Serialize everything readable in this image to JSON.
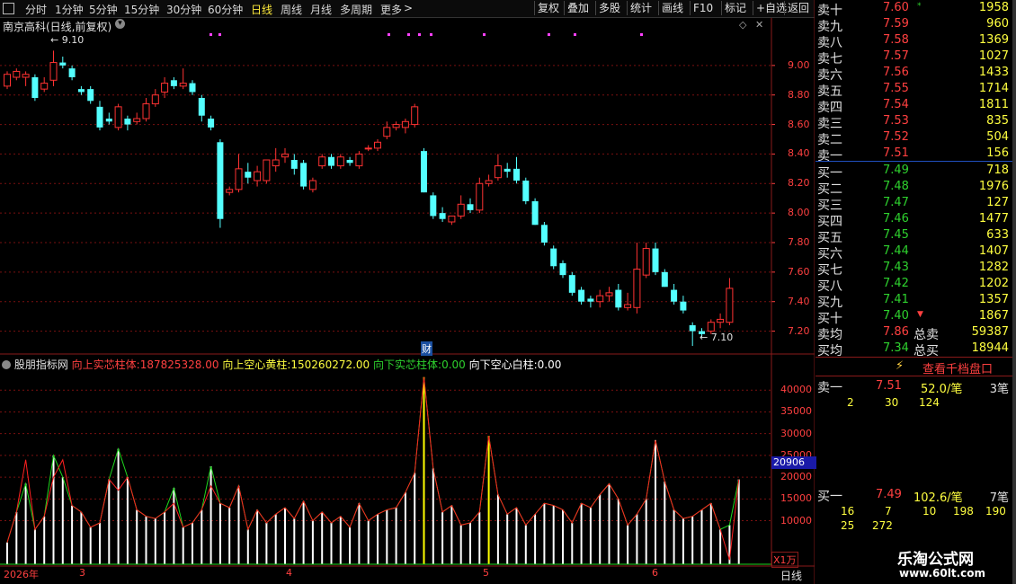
{
  "toolbar": {
    "left_icon": "square-icon",
    "periods": [
      "分时",
      "1分钟",
      "5分钟",
      "15分钟",
      "30分钟",
      "60分钟",
      "日线",
      "周线",
      "月线",
      "多周期",
      "更多"
    ],
    "active_period": "日线",
    "more_arrow": ">",
    "buttons": [
      "复权",
      "叠加",
      "多股",
      "统计",
      "画线",
      "F10",
      "标记",
      "+自选",
      "返回"
    ]
  },
  "chart": {
    "title": "南京高科(日线,前复权)",
    "high_marker": "9.10",
    "low_marker": "7.10",
    "finance_marker": "财",
    "price_axis": [
      "9.00",
      "8.80",
      "8.60",
      "8.40",
      "8.20",
      "8.00",
      "7.80",
      "7.60",
      "7.40",
      "7.20"
    ],
    "volume_axis": [
      "40000",
      "35000",
      "30000",
      "25000",
      "20000",
      "15000",
      "10000"
    ],
    "volume_highlight": "20906",
    "unit_label": "X1万",
    "period_label": "日线",
    "date_labels": [
      "2026年",
      "3",
      "4",
      "5",
      "6"
    ],
    "colors": {
      "up": "#ff3232",
      "down": "#54ffff",
      "grid": "#7a1010",
      "yellow_line": "#ffff00"
    }
  },
  "indicator": {
    "name": "股朋指标网",
    "items": [
      {
        "label": "向上实芯柱体:",
        "value": "187825328.00",
        "color": "#ff4040"
      },
      {
        "label": "向上空心黄柱:",
        "value": "150260272.00",
        "color": "#ffff40"
      },
      {
        "label": "向下实芯柱体:",
        "value": "0.00",
        "color": "#2ed12e"
      },
      {
        "label": "向下空心白柱:",
        "value": "0.00",
        "color": "#ffffff"
      }
    ]
  },
  "chart_data": {
    "type": "bar",
    "title": "南京高科(日线,前复权)",
    "xlabel": "",
    "ylabel": "",
    "ylim": [
      7.1,
      9.2
    ],
    "candles": [
      {
        "o": 8.86,
        "h": 8.96,
        "l": 8.84,
        "c": 8.94
      },
      {
        "o": 8.92,
        "h": 8.98,
        "l": 8.9,
        "c": 8.96
      },
      {
        "o": 8.92,
        "h": 8.96,
        "l": 8.86,
        "c": 8.94
      },
      {
        "o": 8.92,
        "h": 8.94,
        "l": 8.76,
        "c": 8.78
      },
      {
        "o": 8.84,
        "h": 8.92,
        "l": 8.82,
        "c": 8.88
      },
      {
        "o": 8.9,
        "h": 9.1,
        "l": 8.86,
        "c": 9.02
      },
      {
        "o": 9.02,
        "h": 9.06,
        "l": 8.98,
        "c": 9.0
      },
      {
        "o": 8.98,
        "h": 9.0,
        "l": 8.9,
        "c": 8.92
      },
      {
        "o": 8.84,
        "h": 8.86,
        "l": 8.8,
        "c": 8.82
      },
      {
        "o": 8.84,
        "h": 8.86,
        "l": 8.74,
        "c": 8.76
      },
      {
        "o": 8.72,
        "h": 8.76,
        "l": 8.56,
        "c": 8.58
      },
      {
        "o": 8.64,
        "h": 8.68,
        "l": 8.6,
        "c": 8.62
      },
      {
        "o": 8.58,
        "h": 8.74,
        "l": 8.56,
        "c": 8.72
      },
      {
        "o": 8.64,
        "h": 8.66,
        "l": 8.56,
        "c": 8.6
      },
      {
        "o": 8.62,
        "h": 8.68,
        "l": 8.6,
        "c": 8.64
      },
      {
        "o": 8.64,
        "h": 8.78,
        "l": 8.62,
        "c": 8.74
      },
      {
        "o": 8.74,
        "h": 8.84,
        "l": 8.72,
        "c": 8.8
      },
      {
        "o": 8.82,
        "h": 8.92,
        "l": 8.78,
        "c": 8.88
      },
      {
        "o": 8.9,
        "h": 8.92,
        "l": 8.84,
        "c": 8.86
      },
      {
        "o": 8.86,
        "h": 8.98,
        "l": 8.84,
        "c": 8.88
      },
      {
        "o": 8.88,
        "h": 8.9,
        "l": 8.8,
        "c": 8.82
      },
      {
        "o": 8.78,
        "h": 8.8,
        "l": 8.62,
        "c": 8.66
      },
      {
        "o": 8.64,
        "h": 8.66,
        "l": 8.56,
        "c": 8.58
      },
      {
        "o": 8.48,
        "h": 8.5,
        "l": 7.9,
        "c": 7.96
      },
      {
        "o": 8.14,
        "h": 8.18,
        "l": 8.12,
        "c": 8.16
      },
      {
        "o": 8.16,
        "h": 8.4,
        "l": 8.14,
        "c": 8.3
      },
      {
        "o": 8.28,
        "h": 8.34,
        "l": 8.2,
        "c": 8.24
      },
      {
        "o": 8.22,
        "h": 8.32,
        "l": 8.18,
        "c": 8.28
      },
      {
        "o": 8.22,
        "h": 8.36,
        "l": 8.2,
        "c": 8.36
      },
      {
        "o": 8.32,
        "h": 8.44,
        "l": 8.28,
        "c": 8.36
      },
      {
        "o": 8.38,
        "h": 8.44,
        "l": 8.34,
        "c": 8.4
      },
      {
        "o": 8.36,
        "h": 8.4,
        "l": 8.26,
        "c": 8.3
      },
      {
        "o": 8.34,
        "h": 8.36,
        "l": 8.16,
        "c": 8.18
      },
      {
        "o": 8.16,
        "h": 8.24,
        "l": 8.14,
        "c": 8.22
      },
      {
        "o": 8.32,
        "h": 8.4,
        "l": 8.3,
        "c": 8.38
      },
      {
        "o": 8.38,
        "h": 8.4,
        "l": 8.3,
        "c": 8.32
      },
      {
        "o": 8.32,
        "h": 8.4,
        "l": 8.3,
        "c": 8.38
      },
      {
        "o": 8.36,
        "h": 8.38,
        "l": 8.32,
        "c": 8.34
      },
      {
        "o": 8.32,
        "h": 8.42,
        "l": 8.3,
        "c": 8.4
      },
      {
        "o": 8.44,
        "h": 8.46,
        "l": 8.42,
        "c": 8.44
      },
      {
        "o": 8.44,
        "h": 8.5,
        "l": 8.42,
        "c": 8.48
      },
      {
        "o": 8.52,
        "h": 8.62,
        "l": 8.5,
        "c": 8.58
      },
      {
        "o": 8.58,
        "h": 8.62,
        "l": 8.56,
        "c": 8.6
      },
      {
        "o": 8.58,
        "h": 8.64,
        "l": 8.54,
        "c": 8.62
      },
      {
        "o": 8.6,
        "h": 8.74,
        "l": 8.58,
        "c": 8.72
      },
      {
        "o": 8.42,
        "h": 8.44,
        "l": 8.14,
        "c": 8.14
      },
      {
        "o": 8.12,
        "h": 8.14,
        "l": 7.96,
        "c": 7.98
      },
      {
        "o": 8.0,
        "h": 8.04,
        "l": 7.94,
        "c": 7.96
      },
      {
        "o": 7.94,
        "h": 7.98,
        "l": 7.92,
        "c": 7.98
      },
      {
        "o": 7.98,
        "h": 8.12,
        "l": 7.96,
        "c": 8.06
      },
      {
        "o": 8.06,
        "h": 8.1,
        "l": 8.0,
        "c": 8.02
      },
      {
        "o": 8.02,
        "h": 8.24,
        "l": 8.0,
        "c": 8.2
      },
      {
        "o": 8.2,
        "h": 8.26,
        "l": 8.18,
        "c": 8.22
      },
      {
        "o": 8.24,
        "h": 8.4,
        "l": 8.22,
        "c": 8.32
      },
      {
        "o": 8.3,
        "h": 8.34,
        "l": 8.24,
        "c": 8.28
      },
      {
        "o": 8.3,
        "h": 8.38,
        "l": 8.2,
        "c": 8.22
      },
      {
        "o": 8.22,
        "h": 8.24,
        "l": 8.06,
        "c": 8.08
      },
      {
        "o": 8.08,
        "h": 8.1,
        "l": 7.92,
        "c": 7.92
      },
      {
        "o": 7.92,
        "h": 7.94,
        "l": 7.78,
        "c": 7.8
      },
      {
        "o": 7.76,
        "h": 7.78,
        "l": 7.62,
        "c": 7.64
      },
      {
        "o": 7.66,
        "h": 7.68,
        "l": 7.56,
        "c": 7.58
      },
      {
        "o": 7.58,
        "h": 7.6,
        "l": 7.44,
        "c": 7.46
      },
      {
        "o": 7.48,
        "h": 7.5,
        "l": 7.38,
        "c": 7.4
      },
      {
        "o": 7.42,
        "h": 7.44,
        "l": 7.36,
        "c": 7.4
      },
      {
        "o": 7.4,
        "h": 7.48,
        "l": 7.36,
        "c": 7.44
      },
      {
        "o": 7.44,
        "h": 7.5,
        "l": 7.4,
        "c": 7.46
      },
      {
        "o": 7.48,
        "h": 7.52,
        "l": 7.34,
        "c": 7.36
      },
      {
        "o": 7.36,
        "h": 7.46,
        "l": 7.34,
        "c": 7.38
      },
      {
        "o": 7.36,
        "h": 7.8,
        "l": 7.32,
        "c": 7.62
      },
      {
        "o": 7.58,
        "h": 7.8,
        "l": 7.56,
        "c": 7.76
      },
      {
        "o": 7.76,
        "h": 7.8,
        "l": 7.58,
        "c": 7.6
      },
      {
        "o": 7.6,
        "h": 7.62,
        "l": 7.5,
        "c": 7.5
      },
      {
        "o": 7.48,
        "h": 7.52,
        "l": 7.38,
        "c": 7.4
      },
      {
        "o": 7.4,
        "h": 7.44,
        "l": 7.32,
        "c": 7.34
      },
      {
        "o": 7.24,
        "h": 7.26,
        "l": 7.1,
        "c": 7.2
      },
      {
        "o": 7.2,
        "h": 7.22,
        "l": 7.16,
        "c": 7.18
      },
      {
        "o": 7.2,
        "h": 7.28,
        "l": 7.18,
        "c": 7.26
      },
      {
        "o": 7.26,
        "h": 7.32,
        "l": 7.22,
        "c": 7.28
      },
      {
        "o": 7.26,
        "h": 7.56,
        "l": 7.24,
        "c": 7.49
      }
    ],
    "volume_range": [
      0,
      45000
    ],
    "volume_high": 43000,
    "volume_peaks": [
      5000,
      12000,
      18500,
      8000,
      11000,
      25000,
      20000,
      13500,
      12000,
      8500,
      9500,
      19500,
      26500,
      20000,
      12500,
      11000,
      10500,
      12000,
      17500,
      8500,
      9500,
      12500,
      22500,
      14000,
      13000,
      18000,
      8000,
      12500,
      9500,
      11500,
      13000,
      10500,
      14500,
      10000,
      12000,
      9500,
      11000,
      8500,
      14000,
      10000,
      11500,
      12500,
      13000,
      16500,
      21000,
      43000,
      22000,
      12000,
      13500,
      9000,
      9500,
      12000,
      29500,
      16000,
      11500,
      13000,
      9000,
      11500,
      14000,
      13500,
      12500,
      9500,
      14000,
      13000,
      16000,
      18500,
      15000,
      9000,
      11500,
      15000,
      28500,
      19000,
      12500,
      10500,
      11000,
      12500,
      14000,
      8000,
      9000,
      19500
    ],
    "volume_red_line": [
      5000,
      12000,
      24000,
      8000,
      11000,
      20000,
      24000,
      13500,
      12000,
      8500,
      9500,
      19500,
      17000,
      20000,
      12500,
      11000,
      10500,
      12000,
      14000,
      8500,
      9500,
      12500,
      18000,
      14000,
      13000,
      18000,
      8000,
      12500,
      9500,
      11500,
      13000,
      10500,
      14500,
      10000,
      12000,
      9500,
      11000,
      8500,
      14000,
      10000,
      11500,
      12500,
      13000,
      16500,
      21000,
      43000,
      22000,
      12000,
      13500,
      9000,
      9500,
      12000,
      29500,
      16000,
      11500,
      13000,
      9000,
      11500,
      14000,
      13500,
      12500,
      9500,
      14000,
      13000,
      16000,
      18500,
      15000,
      9000,
      11500,
      15000,
      28500,
      19000,
      12500,
      10500,
      11000,
      12500,
      14000,
      8000,
      1000,
      19500
    ]
  },
  "orderbook": {
    "asks": [
      {
        "label": "卖十",
        "price": "7.60",
        "vol": "1958",
        "mark": "*"
      },
      {
        "label": "卖九",
        "price": "7.59",
        "vol": "960"
      },
      {
        "label": "卖八",
        "price": "7.58",
        "vol": "1369"
      },
      {
        "label": "卖七",
        "price": "7.57",
        "vol": "1027"
      },
      {
        "label": "卖六",
        "price": "7.56",
        "vol": "1433"
      },
      {
        "label": "卖五",
        "price": "7.55",
        "vol": "1714"
      },
      {
        "label": "卖四",
        "price": "7.54",
        "vol": "1811"
      },
      {
        "label": "卖三",
        "price": "7.53",
        "vol": "835"
      },
      {
        "label": "卖二",
        "price": "7.52",
        "vol": "504"
      },
      {
        "label": "卖一",
        "price": "7.51",
        "vol": "156"
      }
    ],
    "bids": [
      {
        "label": "买一",
        "price": "7.49",
        "vol": "718"
      },
      {
        "label": "买二",
        "price": "7.48",
        "vol": "1976"
      },
      {
        "label": "买三",
        "price": "7.47",
        "vol": "127"
      },
      {
        "label": "买四",
        "price": "7.46",
        "vol": "1477"
      },
      {
        "label": "买五",
        "price": "7.45",
        "vol": "633"
      },
      {
        "label": "买六",
        "price": "7.44",
        "vol": "1407"
      },
      {
        "label": "买七",
        "price": "7.43",
        "vol": "1282"
      },
      {
        "label": "买八",
        "price": "7.42",
        "vol": "1202"
      },
      {
        "label": "买九",
        "price": "7.41",
        "vol": "1357"
      },
      {
        "label": "买十",
        "price": "7.40",
        "vol": "1867",
        "mark": "▼"
      }
    ],
    "avg_sell": {
      "label": "卖均",
      "price": "7.86",
      "total_label": "总卖",
      "total": "59387"
    },
    "avg_buy": {
      "label": "买均",
      "price": "7.34",
      "total_label": "总买",
      "total": "18944"
    },
    "view_btn": "查看千档盘口",
    "sell1_detail": {
      "label": "卖一",
      "price": "7.51",
      "avg": "52.0/笔",
      "count": "3笔",
      "orders": [
        "2",
        "30",
        "124"
      ]
    },
    "buy1_detail": {
      "label": "买一",
      "price": "7.49",
      "avg": "102.6/笔",
      "count": "7笔",
      "orders": [
        "16",
        "7",
        "10",
        "198",
        "190",
        "25",
        "272"
      ]
    }
  },
  "watermark": {
    "title": "乐淘公式网",
    "url": "www.60lt.com"
  }
}
